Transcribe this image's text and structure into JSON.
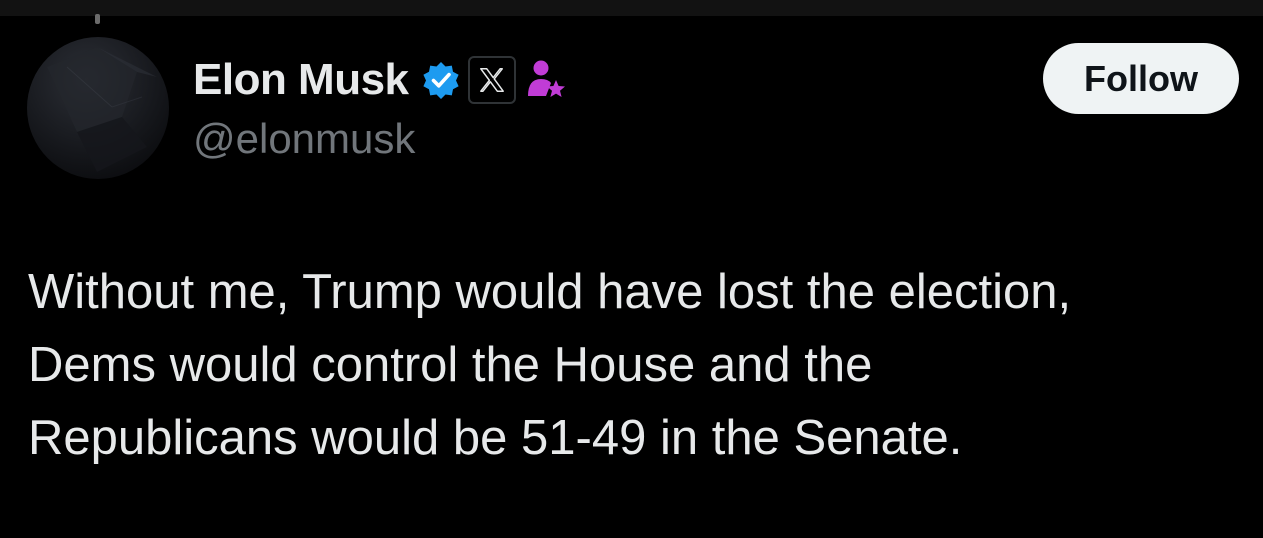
{
  "author": {
    "display_name": "Elon Musk",
    "handle": "@elonmusk"
  },
  "badges": {
    "verified_icon": "verified-check-icon",
    "affiliate_logo_icon": "x-logo-icon",
    "affiliate_person_icon": "person-star-icon",
    "verified_color": "#1d9bf0",
    "affiliate_color": "#c13cd6"
  },
  "actions": {
    "follow_label": "Follow"
  },
  "tweet": {
    "text": "Without me, Trump would have lost the election,\nDems would control the House and the\nRepublicans would be 51-49 in the Senate."
  },
  "colors": {
    "background": "#000000",
    "primary_text": "#e7e9ea",
    "secondary_text": "#71767b",
    "button_bg": "#eff3f4"
  }
}
